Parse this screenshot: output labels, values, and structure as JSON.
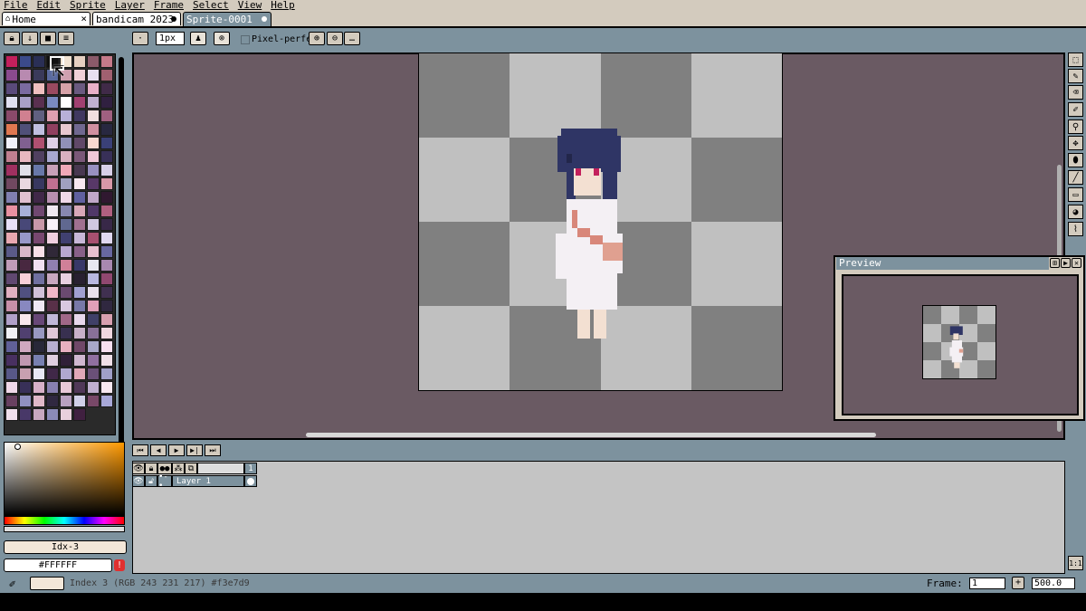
{
  "menu": [
    "File",
    "Edit",
    "Sprite",
    "Layer",
    "Frame",
    "Select",
    "View",
    "Help"
  ],
  "tabs": [
    {
      "label": "Home",
      "icon": "home-icon"
    },
    {
      "label": "bandicam 2023",
      "icon": ""
    },
    {
      "label": "Sprite-0001",
      "icon": ""
    }
  ],
  "toolbar": {
    "brush_size": "1px",
    "pixel_perfect_label": "Pixel-perfect"
  },
  "palette_colors": [
    "#c3205c",
    "#3b4a8a",
    "#2a2f55",
    "#111111",
    "#f1e3d3",
    "#e6d0c2",
    "#8a5a6a",
    "#c67a8a",
    "#8a4a8e",
    "#b88ab0",
    "#3a3a5a",
    "#5a6a9e",
    "#d0a0b0",
    "#f0d0d8",
    "#e8e0f0",
    "#a06070",
    "#5a4a7a",
    "#7a6aa0",
    "#f0c0c0",
    "#9a4a60",
    "#d6a2a8",
    "#6a5a80",
    "#e8b0c8",
    "#402a48",
    "#e0e0f0",
    "#a8a0c8",
    "#5a3050",
    "#7a8ac0",
    "#ffffff",
    "#a04070",
    "#c0b0d0",
    "#302040",
    "#8a4a6a",
    "#d08090",
    "#606080",
    "#e0a0b0",
    "#b8b0d8",
    "#403860",
    "#f0e0e0",
    "#a06080",
    "#e07850",
    "#505078",
    "#c0c0e0",
    "#904060",
    "#e8c8d0",
    "#706890",
    "#d090a0",
    "#282840",
    "#f0f0f8",
    "#806090",
    "#b05070",
    "#e0d0e8",
    "#9090b8",
    "#604868",
    "#f8d8d0",
    "#3a4078",
    "#c08090",
    "#e8b8c0",
    "#504060",
    "#a8a8d0",
    "#d8b0c0",
    "#7a5878",
    "#f0c8d8",
    "#383058",
    "#a03060",
    "#e0e0e8",
    "#6878a8",
    "#c8a0b8",
    "#f0a8b8",
    "#483850",
    "#9890c0",
    "#d8d0e8",
    "#704860",
    "#e8d8e0",
    "#383860",
    "#c07090",
    "#a0a0c0",
    "#f8e8f0",
    "#583868",
    "#d898a8",
    "#8080b0",
    "#e0c0d0",
    "#402848",
    "#b890b0",
    "#f0d8e8",
    "#6060a0",
    "#c0a8c8",
    "#301830",
    "#e890a0",
    "#a8b0d8",
    "#704870",
    "#f0e8f0",
    "#8888b0",
    "#d8a8b8",
    "#503868",
    "#b06080",
    "#e8e0f8",
    "#484878",
    "#c898a8",
    "#f8f0f8",
    "#606890",
    "#a07090",
    "#d0c8e0",
    "#382848",
    "#e8a8b0",
    "#9898c8",
    "#784870",
    "#f0d0e0",
    "#404070",
    "#c8b8d8",
    "#a85070",
    "#e0d8f0",
    "#5a5a88",
    "#d8b8c8",
    "#f8e0e8",
    "#302838",
    "#b8a8d0",
    "#886088",
    "#e8c0d0",
    "#6868a0",
    "#c09cb8",
    "#482840",
    "#f0e0f0",
    "#9080b0",
    "#d08098",
    "#383868",
    "#e8e8f0",
    "#a888b0",
    "#604870",
    "#f8d0d8",
    "#7070a0",
    "#c8a8c0",
    "#e8d0e0",
    "#282030",
    "#b8b8e0",
    "#904870",
    "#e0b0c0",
    "#505080",
    "#d0c0d8",
    "#f0b8c8",
    "#6a4a70",
    "#a0a0d0",
    "#e8e0ec",
    "#403050",
    "#c890a8",
    "#8888c0",
    "#f0e8f4",
    "#583048",
    "#d8c8e0",
    "#7878a8",
    "#e0a0b8",
    "#302840",
    "#b0a0c8",
    "#f8e8ec",
    "#684878",
    "#c0b8d8",
    "#a06888",
    "#e8d8ec",
    "#404068",
    "#d8a0b0",
    "#f0f0f4",
    "#504070",
    "#9898c0",
    "#e0c8d8",
    "#383050",
    "#c8b0c8",
    "#887098",
    "#f0d8e0",
    "#606098",
    "#d0a8c0",
    "#282838",
    "#b8b0d0",
    "#e8b0c0",
    "#704868",
    "#a8a8c8",
    "#f8e0f0",
    "#483060",
    "#c098b0",
    "#7880b0",
    "#e0d0e0",
    "#302038",
    "#d0b8d0",
    "#9070a0",
    "#f0e0e8",
    "#585888",
    "#c8a0b0",
    "#e8e8f4",
    "#402848",
    "#b0a8d0",
    "#e0a8b8",
    "#6a5078",
    "#a0a0c8",
    "#f0d8e8",
    "#383058",
    "#d8b0c8",
    "#8880b0",
    "#e8c8d8",
    "#503858",
    "#c0b0d0",
    "#f8e8f0",
    "#684060",
    "#9090c0",
    "#e0b8c8",
    "#302840",
    "#b8a0c0",
    "#d0d0e8",
    "#784868",
    "#a8a8d8",
    "#f0e0ec",
    "#483868",
    "#c8a8c0",
    "#8a8ab8",
    "#e8d0dc",
    "#402040"
  ],
  "color_index": {
    "label": "Idx-3"
  },
  "hex_value": "#FFFFFF",
  "timeline": {
    "frame_number": "1",
    "layer_name": "Layer 1"
  },
  "preview": {
    "title": "Preview"
  },
  "status": {
    "text": "Index 3 (RGB 243 231 217) #f3e7d9",
    "frame_label": "Frame:",
    "frame_value": "1",
    "zoom": "500.0"
  },
  "colors": {
    "ui_blue": "#7d929e",
    "ui_beige": "#d3cbbe",
    "workspace": "#6a5a63",
    "checker_dark": "#808080",
    "checker_light": "#c0c0c0",
    "bg_color": "#f3e7d9"
  }
}
